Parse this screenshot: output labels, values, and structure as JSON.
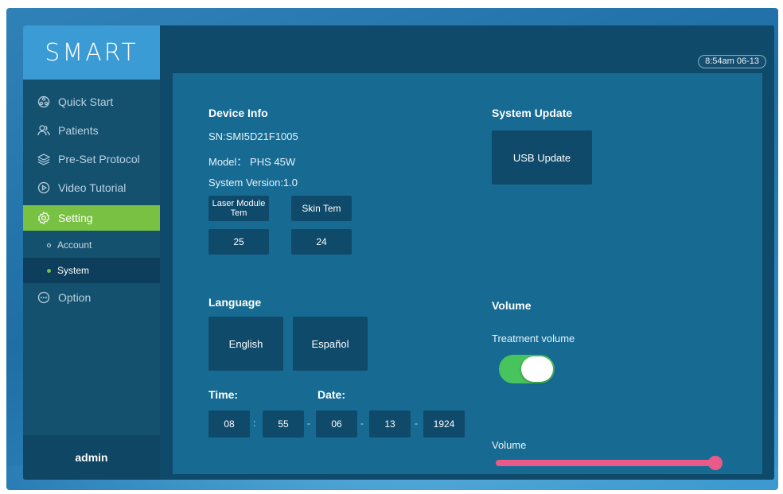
{
  "logo": "SMART",
  "clock": "8:54am 06-13",
  "sidebar": {
    "items": [
      {
        "label": "Quick Start",
        "icon": "quick-start-icon"
      },
      {
        "label": "Patients",
        "icon": "patients-icon"
      },
      {
        "label": "Pre-Set Protocol",
        "icon": "layers-icon"
      },
      {
        "label": "Video Tutorial",
        "icon": "play-icon"
      },
      {
        "label": "Setting",
        "icon": "gear-icon",
        "active": true
      }
    ],
    "sub_items": [
      {
        "label": "Account"
      },
      {
        "label": "System",
        "active": true
      }
    ],
    "option": {
      "label": "Option",
      "icon": "more-icon"
    },
    "user": "admin"
  },
  "device_info": {
    "title": "Device Info",
    "sn": "SN:SMI5D21F1005",
    "model": "Model： PHS 45W",
    "version": "System Version:1.0",
    "laser_label": "Laser Module Tem",
    "skin_label": "Skin Tem",
    "laser_value": "25",
    "skin_value": "24"
  },
  "system_update": {
    "title": "System Update",
    "usb_button": "USB Update"
  },
  "language": {
    "title": "Language",
    "options": [
      "English",
      "Español"
    ]
  },
  "datetime": {
    "time_label": "Time:",
    "date_label": "Date:",
    "hour": "08",
    "minute": "55",
    "month": "06",
    "day": "13",
    "year": "1924",
    "time_sep": ":",
    "date_sep": "-"
  },
  "volume": {
    "title": "Volume",
    "treatment_label": "Treatment volume",
    "treatment_on": true,
    "slider_label": "Volume",
    "slider_level": 1.0
  },
  "colors": {
    "accent_green": "#79c143",
    "toggle_green": "#47c45b",
    "slider_pink": "#e85a88",
    "logo_blue": "#3b9bd4"
  }
}
